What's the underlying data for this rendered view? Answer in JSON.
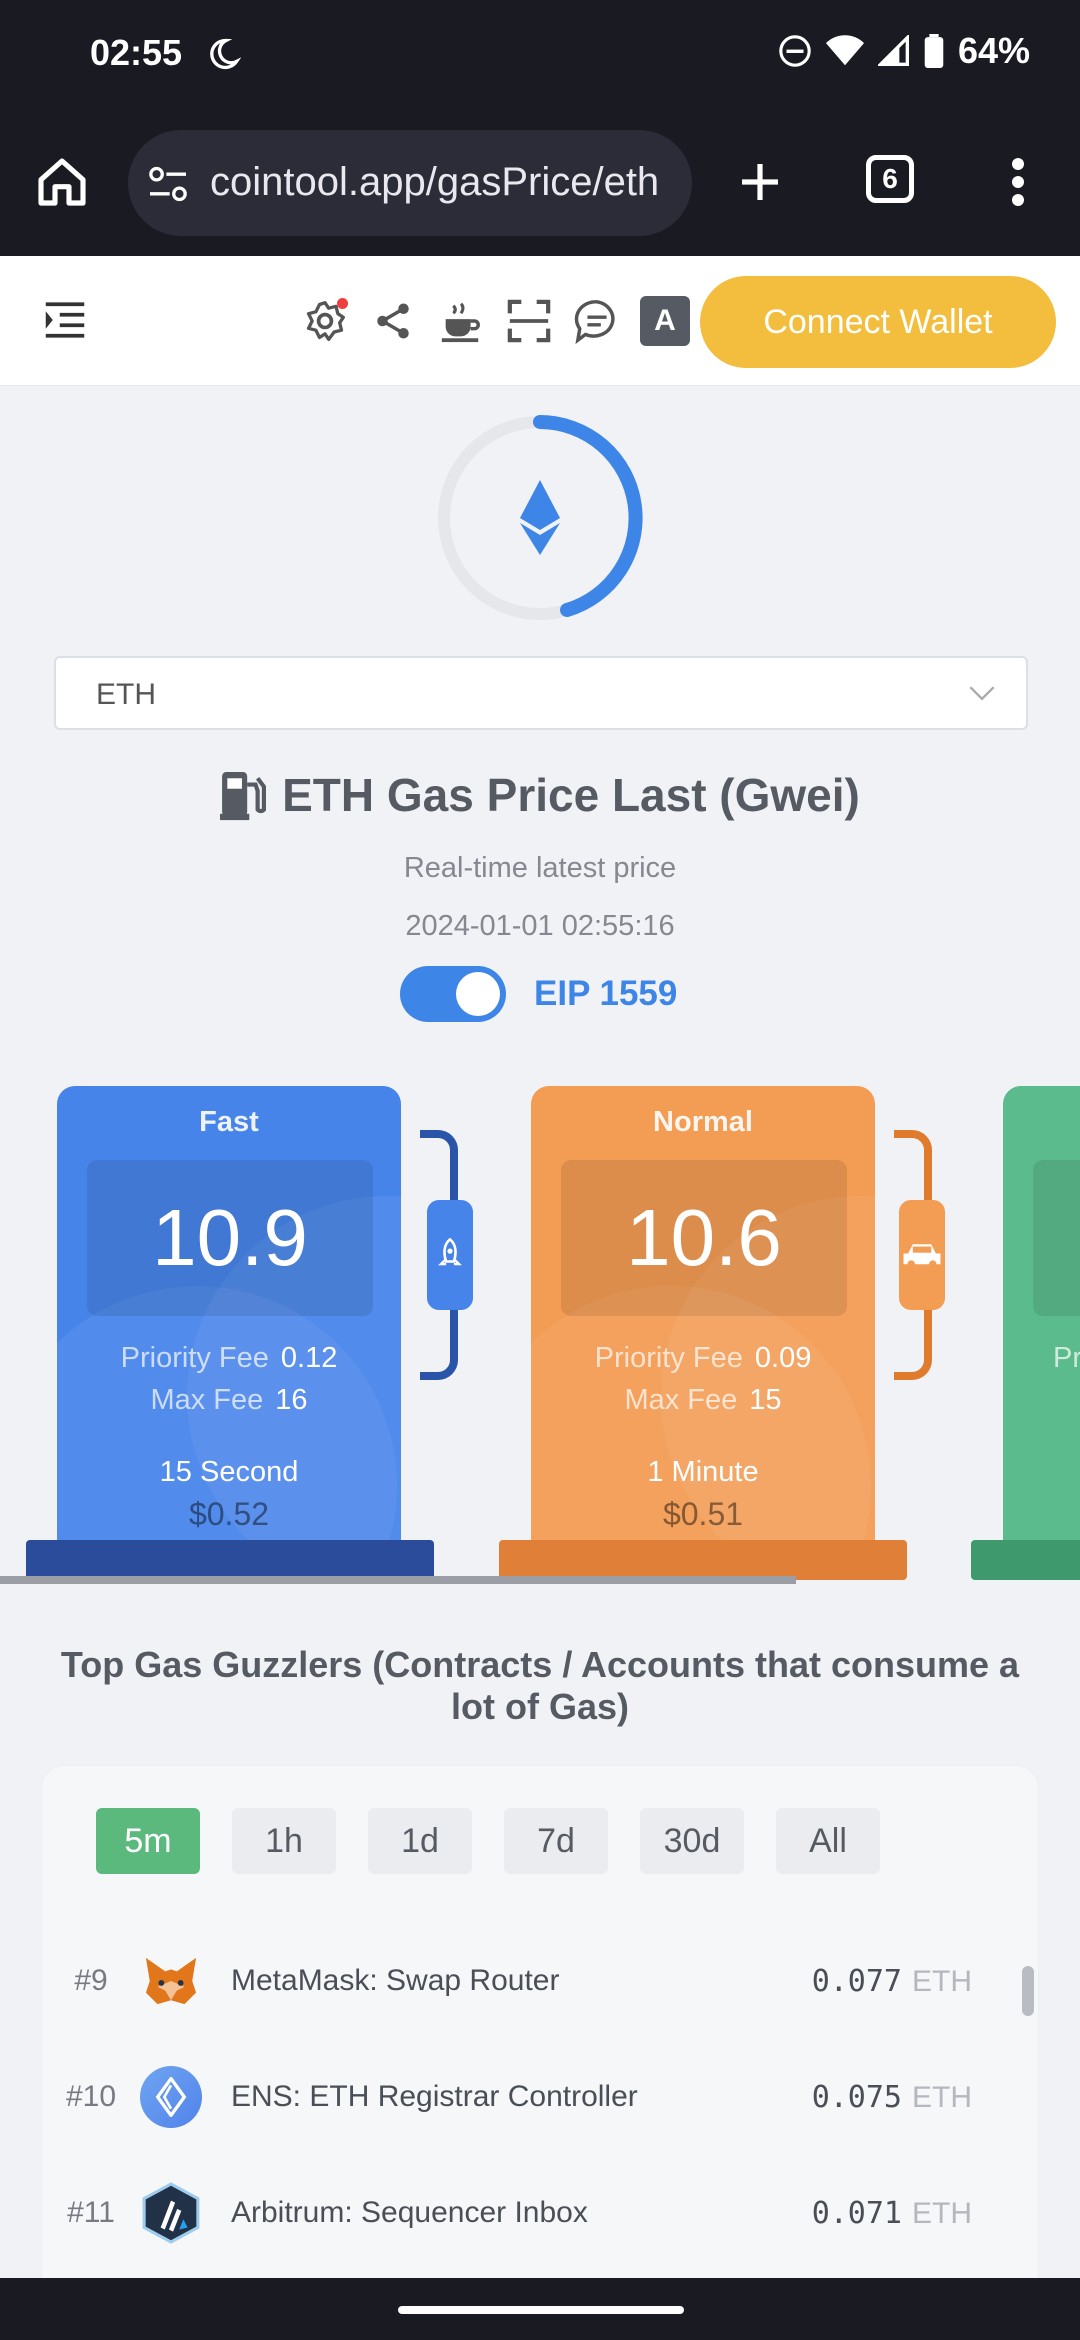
{
  "status_bar": {
    "time": "02:55",
    "battery": "64%"
  },
  "browser": {
    "url": "cointool.app/gasPrice/eth",
    "tab_count": "6"
  },
  "header": {
    "connect_label": "Connect Wallet"
  },
  "chain_select": {
    "value": "ETH"
  },
  "main": {
    "title": "ETH Gas Price Last (Gwei)",
    "subtitle": "Real-time latest price",
    "timestamp": "2024-01-01 02:55:16",
    "eip_label": "EIP 1559",
    "eip_enabled": true
  },
  "pumps": [
    {
      "name": "Fast",
      "price": "10.9",
      "priority_label": "Priority Fee",
      "priority_value": "0.12",
      "max_label": "Max Fee",
      "max_value": "16",
      "time": "15 Second",
      "cost": "$0.52",
      "color": "#4784ea",
      "icon": "rocket-icon"
    },
    {
      "name": "Normal",
      "price": "10.6",
      "priority_label": "Priority Fee",
      "priority_value": "0.09",
      "max_label": "Max Fee",
      "max_value": "15",
      "time": "1 Minute",
      "cost": "$0.51",
      "color": "#f39c53",
      "icon": "car-icon"
    },
    {
      "priority_label": "Pr",
      "color": "#5cbb8d"
    }
  ],
  "guzzlers": {
    "title": "Top Gas Guzzlers (Contracts / Accounts that consume a lot of Gas)",
    "tabs": [
      "5m",
      "1h",
      "1d",
      "7d",
      "30d",
      "All"
    ],
    "active_tab": "5m",
    "rows": [
      {
        "rank": "#9",
        "name": "MetaMask: Swap Router",
        "amount": "0.077",
        "unit": "ETH",
        "icon": "metamask-icon"
      },
      {
        "rank": "#10",
        "name": "ENS: ETH Registrar Controller",
        "amount": "0.075",
        "unit": "ETH",
        "icon": "ens-icon"
      },
      {
        "rank": "#11",
        "name": "Arbitrum: Sequencer Inbox",
        "amount": "0.071",
        "unit": "ETH",
        "icon": "arbitrum-icon"
      }
    ]
  }
}
